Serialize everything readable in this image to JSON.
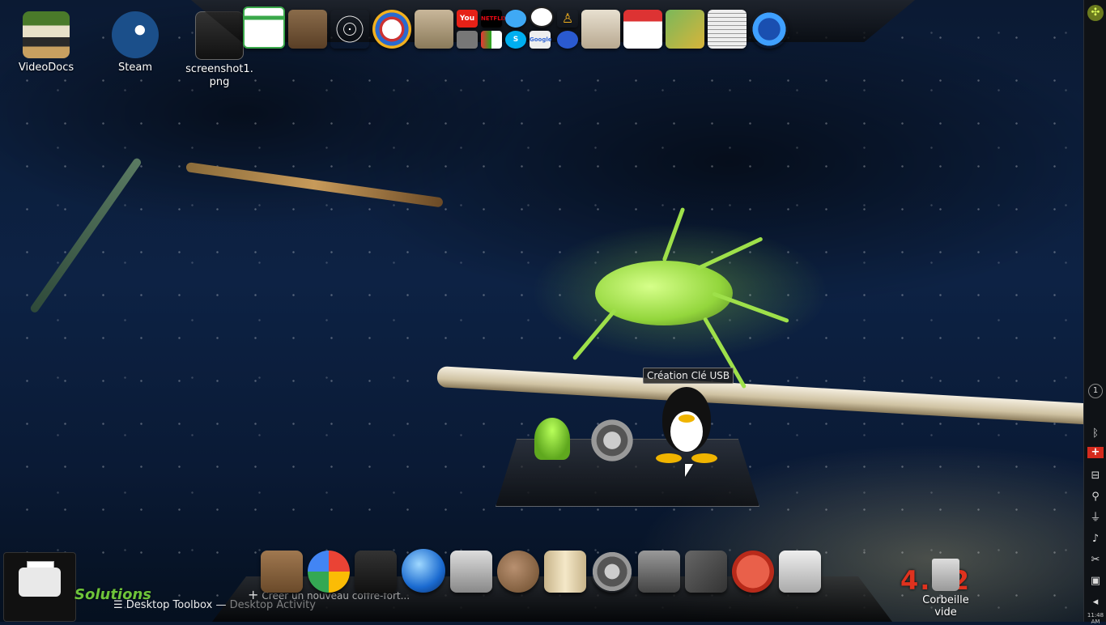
{
  "desktop_icons": [
    {
      "label": "VideoDocs",
      "icon": "books-icon"
    },
    {
      "label": "Steam",
      "icon": "steam-icon"
    },
    {
      "label": "screenshot1.png",
      "icon": "image-file-icon"
    }
  ],
  "top_dock": {
    "small_labels": {
      "youtube": "You Tube",
      "netflix": "NETFLIX",
      "google": "Google"
    },
    "apps": [
      "spreadsheet-icon",
      "box-icon",
      "spiderweb-icon",
      "social-media-icon",
      "tape-recorder-icon",
      "youtube-icon",
      "netflix-icon",
      "periscope-icon",
      "skype-icon",
      "clock-icon",
      "google-icon",
      "joystick-icon",
      "calendar-icon",
      "money-icon",
      "news-icon",
      "telephone-icon"
    ]
  },
  "floating_shelf": {
    "tooltip": "Création Clé USB",
    "apps": [
      "android-icon",
      "gear-tools-icon",
      "tux-icon"
    ]
  },
  "bottom_dock": {
    "apps": [
      "toolbox-icon",
      "pinwheel-icon",
      "camera-icon",
      "media-player-icon",
      "projector-icon",
      "potato-icon",
      "book-icon",
      "settings-icon",
      "block-icon",
      "magic-tools-icon",
      "power-icon",
      "puzzle-icon"
    ],
    "vault_hint": "Créer un nouveau coffre-fort..."
  },
  "activity_bar": {
    "toolbox": "Desktop Toolbox",
    "separator": "—",
    "activity": "Desktop Activity"
  },
  "branding": {
    "solutions": "Solutions",
    "version": "4.02"
  },
  "trash": {
    "label_line1": "Corbeille",
    "label_line2": "vide"
  },
  "right_panel": {
    "items": [
      "app-launcher-icon",
      "info-icon",
      "bluetooth-icon",
      "swiss-flag-icon",
      "network-icon",
      "user-icon",
      "usb-icon",
      "volume-icon",
      "scissors-icon",
      "lock-icon",
      "arrow-left-icon"
    ],
    "clock": "11:48 AM",
    "info_badge": "1"
  },
  "colors": {
    "accent_red": "#e0321e",
    "accent_green": "#6ec43a"
  }
}
